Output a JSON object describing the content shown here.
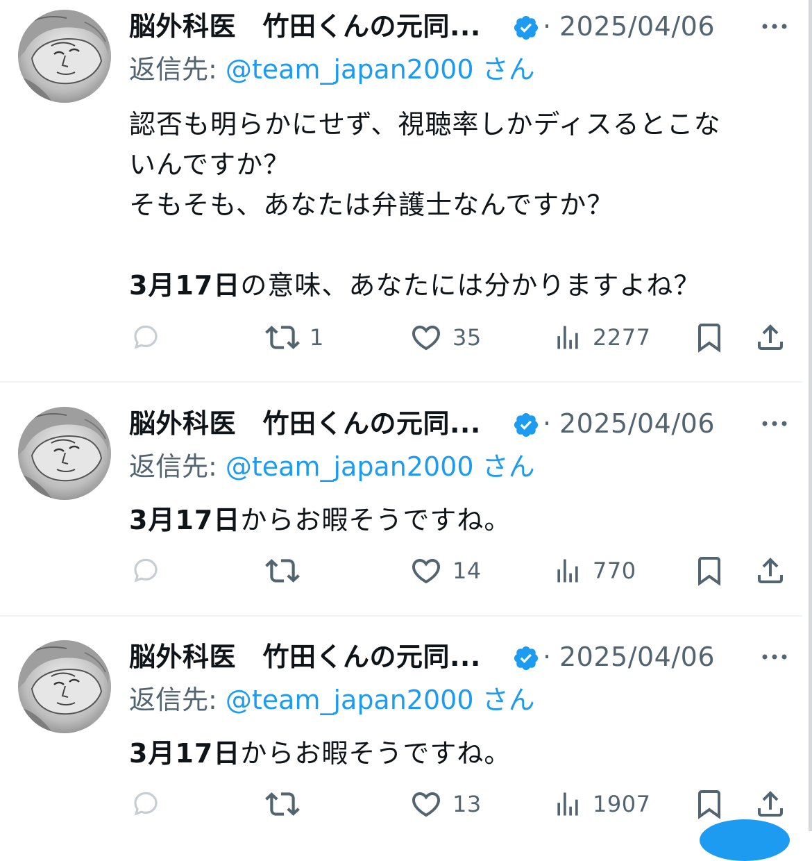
{
  "tweets": [
    {
      "display_name": "脳外科医　竹田くんの元同...",
      "timestamp": "2025/04/06",
      "reply_prefix": "返信先: ",
      "reply_handle": "@team_japan2000",
      "reply_suffix": " さん",
      "body_lines": [
        [
          {
            "text": "認否も明らかにせず、視聴率しかディスるとこな",
            "bold": false
          }
        ],
        [
          {
            "text": "いんですか？",
            "bold": false
          }
        ],
        [
          {
            "text": "そもそも、あなたは弁護士なんですか？",
            "bold": false
          }
        ],
        [],
        [
          {
            "text": "3月17日",
            "bold": true
          },
          {
            "text": "の意味、あなたには分かりますよね？",
            "bold": false
          }
        ]
      ],
      "stats": {
        "replies": "",
        "retweets": "1",
        "likes": "35",
        "views": "2277"
      }
    },
    {
      "display_name": "脳外科医　竹田くんの元同...",
      "timestamp": "2025/04/06",
      "reply_prefix": "返信先: ",
      "reply_handle": "@team_japan2000",
      "reply_suffix": " さん",
      "body_lines": [
        [
          {
            "text": "3月17日",
            "bold": true
          },
          {
            "text": "からお暇そうですね。",
            "bold": false
          }
        ]
      ],
      "stats": {
        "replies": "",
        "retweets": "",
        "likes": "14",
        "views": "770"
      }
    },
    {
      "display_name": "脳外科医　竹田くんの元同...",
      "timestamp": "2025/04/06",
      "reply_prefix": "返信先: ",
      "reply_handle": "@team_japan2000",
      "reply_suffix": " さん",
      "body_lines": [
        [
          {
            "text": "3月17日",
            "bold": true
          },
          {
            "text": "からお暇そうですね。",
            "bold": false
          }
        ]
      ],
      "stats": {
        "replies": "",
        "retweets": "",
        "likes": "13",
        "views": "1907"
      }
    }
  ],
  "icons": {
    "verified": "verified-badge-icon",
    "more": "more-dots-icon",
    "reply": "reply-bubble-icon",
    "retweet": "retweet-icon",
    "like": "heart-icon",
    "views": "views-bar-icon",
    "bookmark": "bookmark-icon",
    "share": "share-icon"
  },
  "colors": {
    "accent": "#1d9bf0",
    "text_primary": "#0f1419",
    "text_secondary": "#536471",
    "divider": "#eff3f4"
  }
}
